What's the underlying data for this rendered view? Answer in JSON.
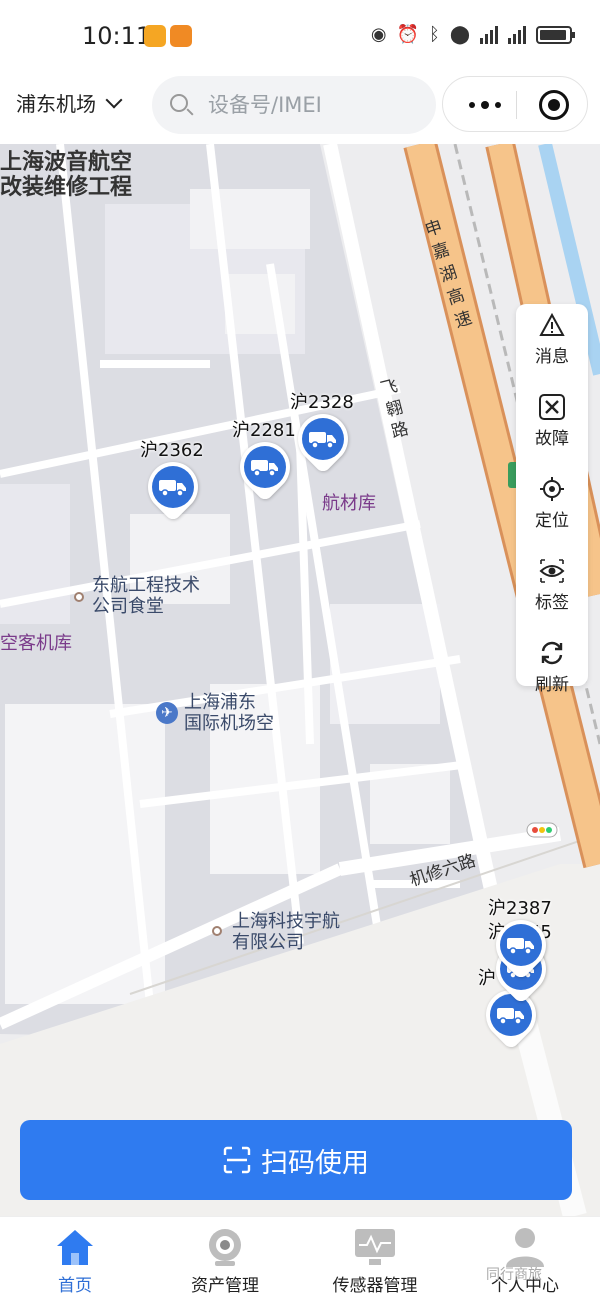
{
  "status_bar": {
    "time": "10:11"
  },
  "header": {
    "city": "浦东机场",
    "search_placeholder": "设备号/IMEI"
  },
  "map": {
    "labels": [
      {
        "text": "上海波音航空\n改装维修工程"
      },
      {
        "text": "东航工程技术\n公司食堂"
      },
      {
        "text": "空客机库"
      },
      {
        "text": "上海浦东\n国际机场空"
      },
      {
        "text": "上海科技宇航\n有限公司"
      },
      {
        "text": "航材库"
      }
    ],
    "roads": [
      "申嘉湖高速",
      "飞翱路",
      "机修六路"
    ],
    "vehicles": [
      "沪2362",
      "沪2281",
      "沪2328",
      "沪2387",
      "沪2355",
      "沪"
    ]
  },
  "tools": [
    {
      "label": "消息",
      "icon": "warning-icon"
    },
    {
      "label": "故障",
      "icon": "wrench-icon"
    },
    {
      "label": "定位",
      "icon": "locate-icon"
    },
    {
      "label": "标签",
      "icon": "eye-icon"
    },
    {
      "label": "刷新",
      "icon": "refresh-icon"
    }
  ],
  "scan_button": {
    "label": "扫码使用"
  },
  "tabs": [
    {
      "label": "首页",
      "icon": "home-icon",
      "active": true
    },
    {
      "label": "资产管理",
      "icon": "camera-icon",
      "active": false
    },
    {
      "label": "传感器管理",
      "icon": "monitor-icon",
      "active": false
    },
    {
      "label": "个人中心",
      "icon": "user-icon",
      "active": false
    }
  ],
  "watermark": "同行商旅",
  "colors": {
    "accent": "#2f7bf0",
    "vehicle": "#2f6fd6",
    "highway": "#f0a860"
  }
}
